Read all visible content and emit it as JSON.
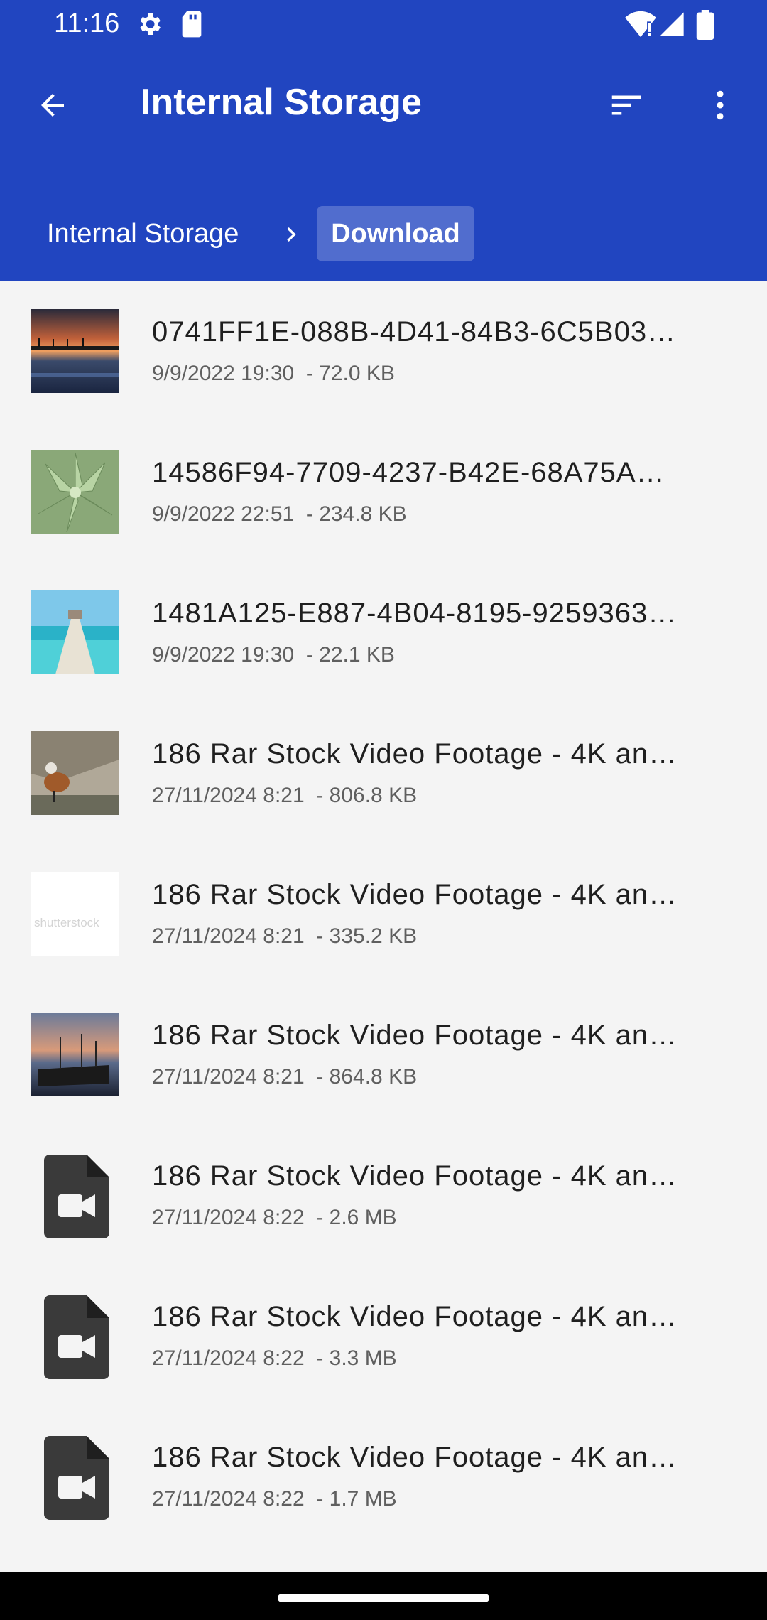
{
  "status_bar": {
    "time": "11:16",
    "icons_left": [
      "gear-icon",
      "sd-card-icon"
    ],
    "icons_right": [
      "wifi-icon",
      "signal-icon",
      "battery-icon"
    ]
  },
  "toolbar": {
    "title": "Internal Storage",
    "back_icon": "arrow-back-icon",
    "sort_icon": "sort-icon",
    "more_icon": "more-vert-icon"
  },
  "breadcrumb": {
    "root": "Internal Storage",
    "current": "Download"
  },
  "files": [
    {
      "name": "0741FF1E-088B-4D41-84B3-6C5B03…",
      "date": "9/9/2022 19:30",
      "size": "72.0 KB",
      "thumb": "sunset-pier"
    },
    {
      "name": "14586F94-7709-4237-B42E-68A75A…",
      "date": "9/9/2022 22:51",
      "size": "234.8 KB",
      "thumb": "succulent"
    },
    {
      "name": "1481A125-E887-4B04-8195-9259363…",
      "date": "9/9/2022 19:30",
      "size": "22.1 KB",
      "thumb": "beach-dock"
    },
    {
      "name": "186 Rar Stock Video Footage - 4K an…",
      "date": "27/11/2024 8:21",
      "size": "806.8 KB",
      "thumb": "bird-stock"
    },
    {
      "name": "186 Rar Stock Video Footage - 4K an…",
      "date": "27/11/2024 8:21",
      "size": "335.2 KB",
      "thumb": "shutterstock-white",
      "thumb_text": "shutterstock"
    },
    {
      "name": "186 Rar Stock Video Footage - 4K an…",
      "date": "27/11/2024 8:21",
      "size": "864.8 KB",
      "thumb": "boats-dusk"
    },
    {
      "name": "186 Rar Stock Video Footage - 4K an…",
      "date": "27/11/2024 8:22",
      "size": "2.6 MB",
      "thumb": "video-file-icon"
    },
    {
      "name": "186 Rar Stock Video Footage - 4K an…",
      "date": "27/11/2024 8:22",
      "size": "3.3 MB",
      "thumb": "video-file-icon"
    },
    {
      "name": "186 Rar Stock Video Footage - 4K an…",
      "date": "27/11/2024 8:22",
      "size": "1.7 MB",
      "thumb": "video-file-icon"
    }
  ],
  "colors": {
    "header": "#2145c0",
    "background": "#f4f4f4",
    "icon_dark": "#3a3a3a"
  }
}
